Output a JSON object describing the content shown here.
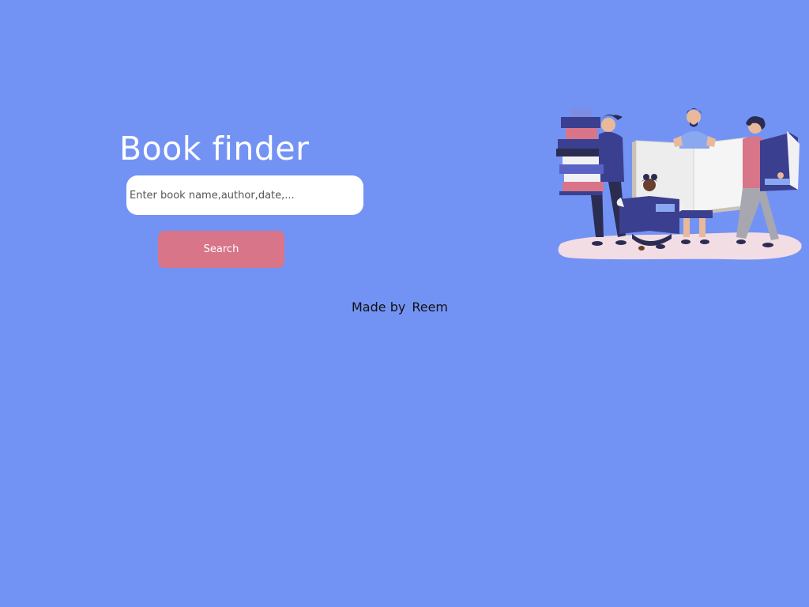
{
  "header": {
    "title": "Book finder"
  },
  "search": {
    "placeholder": "Enter book name,author,date,...",
    "value": "",
    "button_label": "Search"
  },
  "footer": {
    "made_by_label": "Made by",
    "author": "Reem"
  },
  "illustration": {
    "icon": "people-reading-books-illustration"
  },
  "colors": {
    "background": "#7393f4",
    "button": "#d87588",
    "input_bg": "#ffffff",
    "title": "#ffffff"
  }
}
